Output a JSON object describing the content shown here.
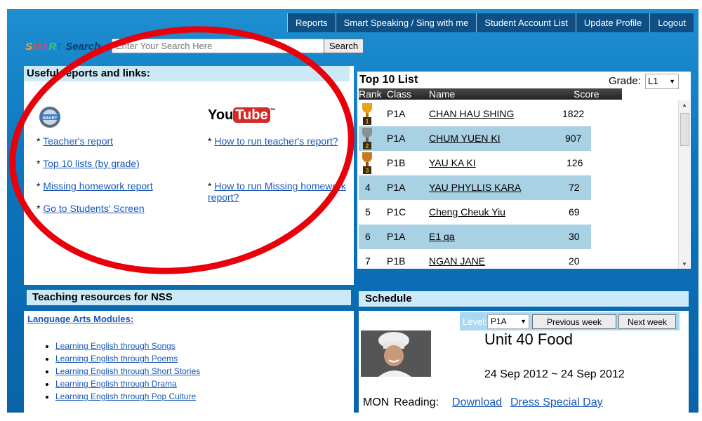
{
  "nav": [
    "Reports",
    "Smart Speaking / Sing with me",
    "Student Account List",
    "Update Profile",
    "Logout"
  ],
  "logo": {
    "letters": [
      "S",
      "M",
      "A",
      "R",
      "T",
      " Search"
    ],
    "colors": [
      "#f5a623",
      "#e74c3c",
      "#9b59b6",
      "#2ecc71",
      "#3498db",
      "#0a3d6e"
    ]
  },
  "search": {
    "placeholder": "Enter Your Search Here",
    "button": "Search"
  },
  "useful": {
    "title": "Useful reports and links:",
    "bullet": "*",
    "links": [
      "Teacher's report",
      "Top 10 lists (by grade)",
      "Missing homework report",
      "Go to Students' Screen"
    ],
    "youtube_links": [
      "How to run teacher's report?",
      "How to run Missing homework report?"
    ],
    "youtube_logo": {
      "you": "You",
      "tube": "Tube",
      "tm": "™"
    }
  },
  "top10": {
    "title": "Top 10 List",
    "grade_label": "Grade:",
    "grade_value": "L1",
    "headers": {
      "rank": "Rank",
      "class": "Class",
      "name": "Name",
      "score": "Score"
    },
    "rows": [
      {
        "rank": "1",
        "class": "P1A",
        "name": "CHAN HAU SHING",
        "score": "1822"
      },
      {
        "rank": "2",
        "class": "P1A",
        "name": "CHUM YUEN KI",
        "score": "907"
      },
      {
        "rank": "3",
        "class": "P1B",
        "name": "YAU KA KI",
        "score": "126"
      },
      {
        "rank": "4",
        "class": "P1A",
        "name": "YAU PHYLLIS KARA",
        "score": "72"
      },
      {
        "rank": "5",
        "class": "P1C",
        "name": "Cheng Cheuk Yiu",
        "score": "69"
      },
      {
        "rank": "6",
        "class": "P1A",
        "name": "E1 qa",
        "score": "30"
      },
      {
        "rank": "7",
        "class": "P1B",
        "name": "NGAN JANE",
        "score": "20"
      }
    ]
  },
  "nss": {
    "title": "Teaching resources for NSS",
    "module": "Language Arts Modules:",
    "items": [
      "Learning English through Songs",
      "Learning English through Poems",
      "Learning English through Short Stories",
      "Learning English through Drama",
      "Learning English through Pop Culture"
    ]
  },
  "schedule": {
    "title": "Schedule",
    "level_label": "Level:",
    "level_value": "P1A",
    "prev": "Previous week",
    "next": "Next week",
    "unit": "Unit 40 Food",
    "dates": "24 Sep 2012 ~ 24 Sep 2012",
    "day": "MON",
    "activity": "Reading:",
    "download": "Download",
    "special": "Dress Special Day"
  }
}
